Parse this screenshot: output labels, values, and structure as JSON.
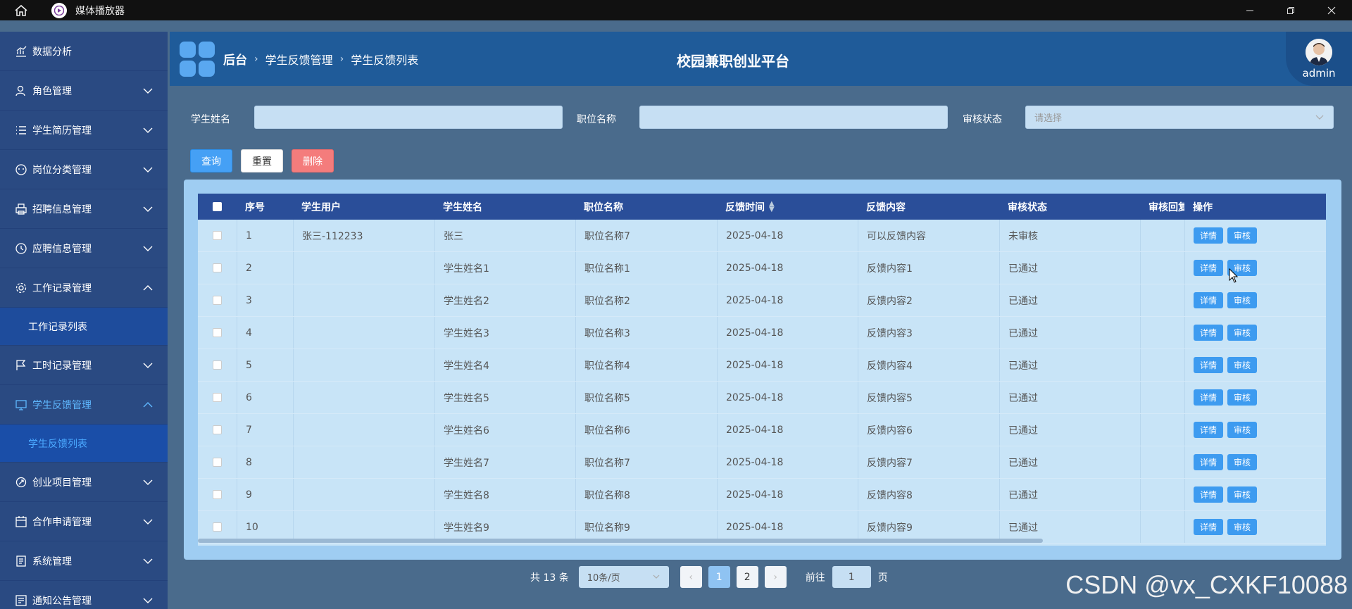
{
  "window": {
    "title": "媒体播放器"
  },
  "sidebar": {
    "items": [
      {
        "label": "数据分析",
        "icon": "chart-icon",
        "expandable": false
      },
      {
        "label": "角色管理",
        "icon": "user-icon",
        "expandable": true
      },
      {
        "label": "学生简历管理",
        "icon": "list-icon",
        "expandable": true
      },
      {
        "label": "岗位分类管理",
        "icon": "category-icon",
        "expandable": true
      },
      {
        "label": "招聘信息管理",
        "icon": "printer-icon",
        "expandable": true
      },
      {
        "label": "应聘信息管理",
        "icon": "clock-icon",
        "expandable": true
      },
      {
        "label": "工作记录管理",
        "icon": "gear-icon",
        "expandable": true,
        "open": true,
        "children": [
          "工作记录列表"
        ]
      },
      {
        "label": "工时记录管理",
        "icon": "flag-icon",
        "expandable": true
      },
      {
        "label": "学生反馈管理",
        "icon": "monitor-icon",
        "expandable": true,
        "open": true,
        "active": true,
        "children": [
          "学生反馈列表"
        ]
      },
      {
        "label": "创业项目管理",
        "icon": "rocket-icon",
        "expandable": true
      },
      {
        "label": "合作申请管理",
        "icon": "calendar-icon",
        "expandable": true
      },
      {
        "label": "系统管理",
        "icon": "system-icon",
        "expandable": true
      },
      {
        "label": "通知公告管理",
        "icon": "notice-icon",
        "expandable": true
      }
    ]
  },
  "header": {
    "breadcrumb": [
      "后台",
      "学生反馈管理",
      "学生反馈列表"
    ],
    "site_title": "校园兼职创业平台",
    "user": "admin"
  },
  "search": {
    "student_name_label": "学生姓名",
    "job_name_label": "职位名称",
    "status_label": "审核状态",
    "status_placeholder": "请选择"
  },
  "buttons": {
    "query": "查询",
    "reset": "重置",
    "delete": "删除"
  },
  "table": {
    "columns": [
      "序号",
      "学生用户",
      "学生姓名",
      "职位名称",
      "反馈时间",
      "反馈内容",
      "审核状态",
      "审核回复",
      "操作"
    ],
    "detail_label": "详情",
    "review_label": "审核",
    "rows": [
      [
        "1",
        "张三-112233",
        "张三",
        "职位名称7",
        "2025-04-18",
        "可以反馈内容",
        "未审核"
      ],
      [
        "2",
        "",
        "学生姓名1",
        "职位名称1",
        "2025-04-18",
        "反馈内容1",
        "已通过"
      ],
      [
        "3",
        "",
        "学生姓名2",
        "职位名称2",
        "2025-04-18",
        "反馈内容2",
        "已通过"
      ],
      [
        "4",
        "",
        "学生姓名3",
        "职位名称3",
        "2025-04-18",
        "反馈内容3",
        "已通过"
      ],
      [
        "5",
        "",
        "学生姓名4",
        "职位名称4",
        "2025-04-18",
        "反馈内容4",
        "已通过"
      ],
      [
        "6",
        "",
        "学生姓名5",
        "职位名称5",
        "2025-04-18",
        "反馈内容5",
        "已通过"
      ],
      [
        "7",
        "",
        "学生姓名6",
        "职位名称6",
        "2025-04-18",
        "反馈内容6",
        "已通过"
      ],
      [
        "8",
        "",
        "学生姓名7",
        "职位名称7",
        "2025-04-18",
        "反馈内容7",
        "已通过"
      ],
      [
        "9",
        "",
        "学生姓名8",
        "职位名称8",
        "2025-04-18",
        "反馈内容8",
        "已通过"
      ],
      [
        "10",
        "",
        "学生姓名9",
        "职位名称9",
        "2025-04-18",
        "反馈内容9",
        "已通过"
      ]
    ]
  },
  "pagination": {
    "total_text": "共 13 条",
    "page_size": "10条/页",
    "prev": "‹",
    "pages": [
      "1",
      "2"
    ],
    "next": "›",
    "current_page": "1",
    "goto_label": "前往",
    "goto_value": "1",
    "page_unit": "页"
  },
  "watermark": "CSDN @vx_CXKF10088"
}
